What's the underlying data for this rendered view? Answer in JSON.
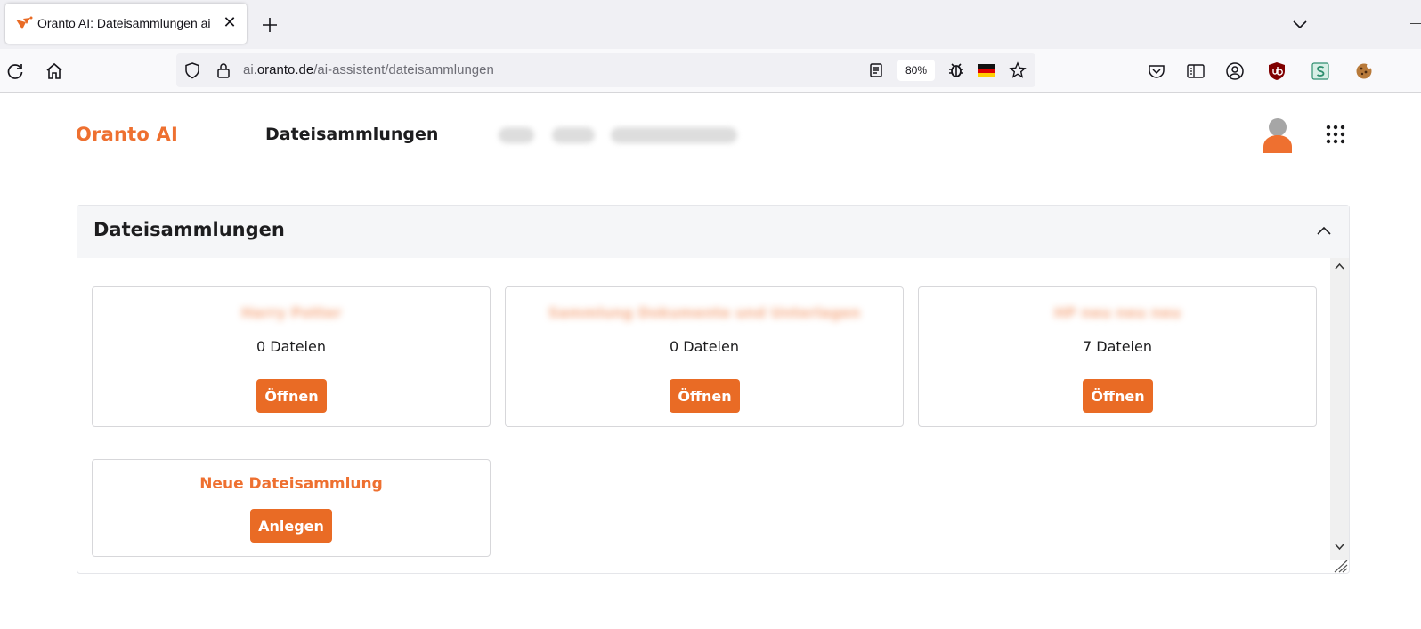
{
  "browser": {
    "tab_title": "Oranto AI: Dateisammlungen ai",
    "tab_close": "✕",
    "url_host_prefix": "ai.",
    "url_host_domain": "oranto.de",
    "url_path": "/ai-assistent/dateisammlungen",
    "zoom": "80%",
    "icons": [
      "reload-icon",
      "home-icon",
      "shield-icon",
      "lock-icon",
      "reader-view-icon",
      "bug-icon",
      "german-flag-icon",
      "star-icon",
      "pocket-icon",
      "sidebar-icon",
      "account-icon",
      "ublock-icon",
      "s-extension-icon",
      "cookie-icon"
    ]
  },
  "header": {
    "brand": "Oranto AI",
    "breadcrumb_current": "Dateisammlungen"
  },
  "panel": {
    "title": "Dateisammlungen"
  },
  "collections": [
    {
      "name": "Harry Potter",
      "count": "0 Dateien",
      "button": "Öffnen"
    },
    {
      "name": "Sammlung Dokumente und Unterlagen",
      "count": "0 Dateien",
      "button": "Öffnen"
    },
    {
      "name": "HP neu neu neu",
      "count": "7 Dateien",
      "button": "Öffnen"
    }
  ],
  "new_collection": {
    "title": "Neue Dateisammlung",
    "button": "Anlegen"
  },
  "colors": {
    "accent": "#ee7030",
    "button": "#e96b25"
  }
}
